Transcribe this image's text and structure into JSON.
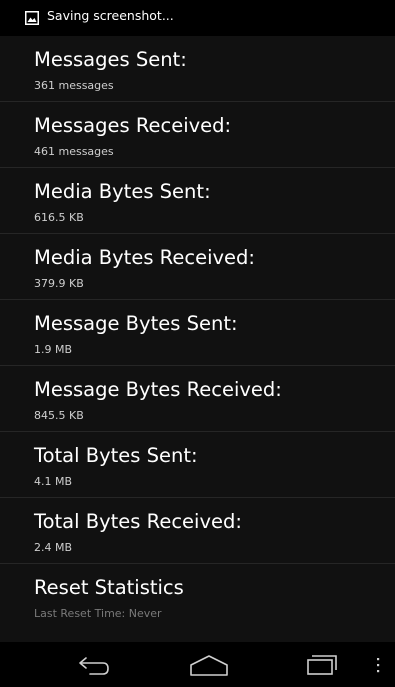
{
  "status_bar": {
    "notification_icon": "image-icon",
    "text": "Saving screenshot..."
  },
  "stats": [
    {
      "title": "Messages Sent:",
      "summary": "361 messages"
    },
    {
      "title": "Messages Received:",
      "summary": "461 messages"
    },
    {
      "title": "Media Bytes Sent:",
      "summary": "616.5 KB"
    },
    {
      "title": "Media Bytes Received:",
      "summary": "379.9 KB"
    },
    {
      "title": "Message Bytes Sent:",
      "summary": "1.9 MB"
    },
    {
      "title": "Message Bytes Received:",
      "summary": "845.5 KB"
    },
    {
      "title": "Total Bytes Sent:",
      "summary": "4.1 MB"
    },
    {
      "title": "Total Bytes Received:",
      "summary": "2.4 MB"
    },
    {
      "title": "Reset Statistics",
      "summary": "Last Reset Time: Never"
    }
  ],
  "nav_bar": {
    "back_icon": "back-icon",
    "home_icon": "home-icon",
    "recents_icon": "recent-apps-icon",
    "menu_icon": "overflow-menu-icon"
  }
}
